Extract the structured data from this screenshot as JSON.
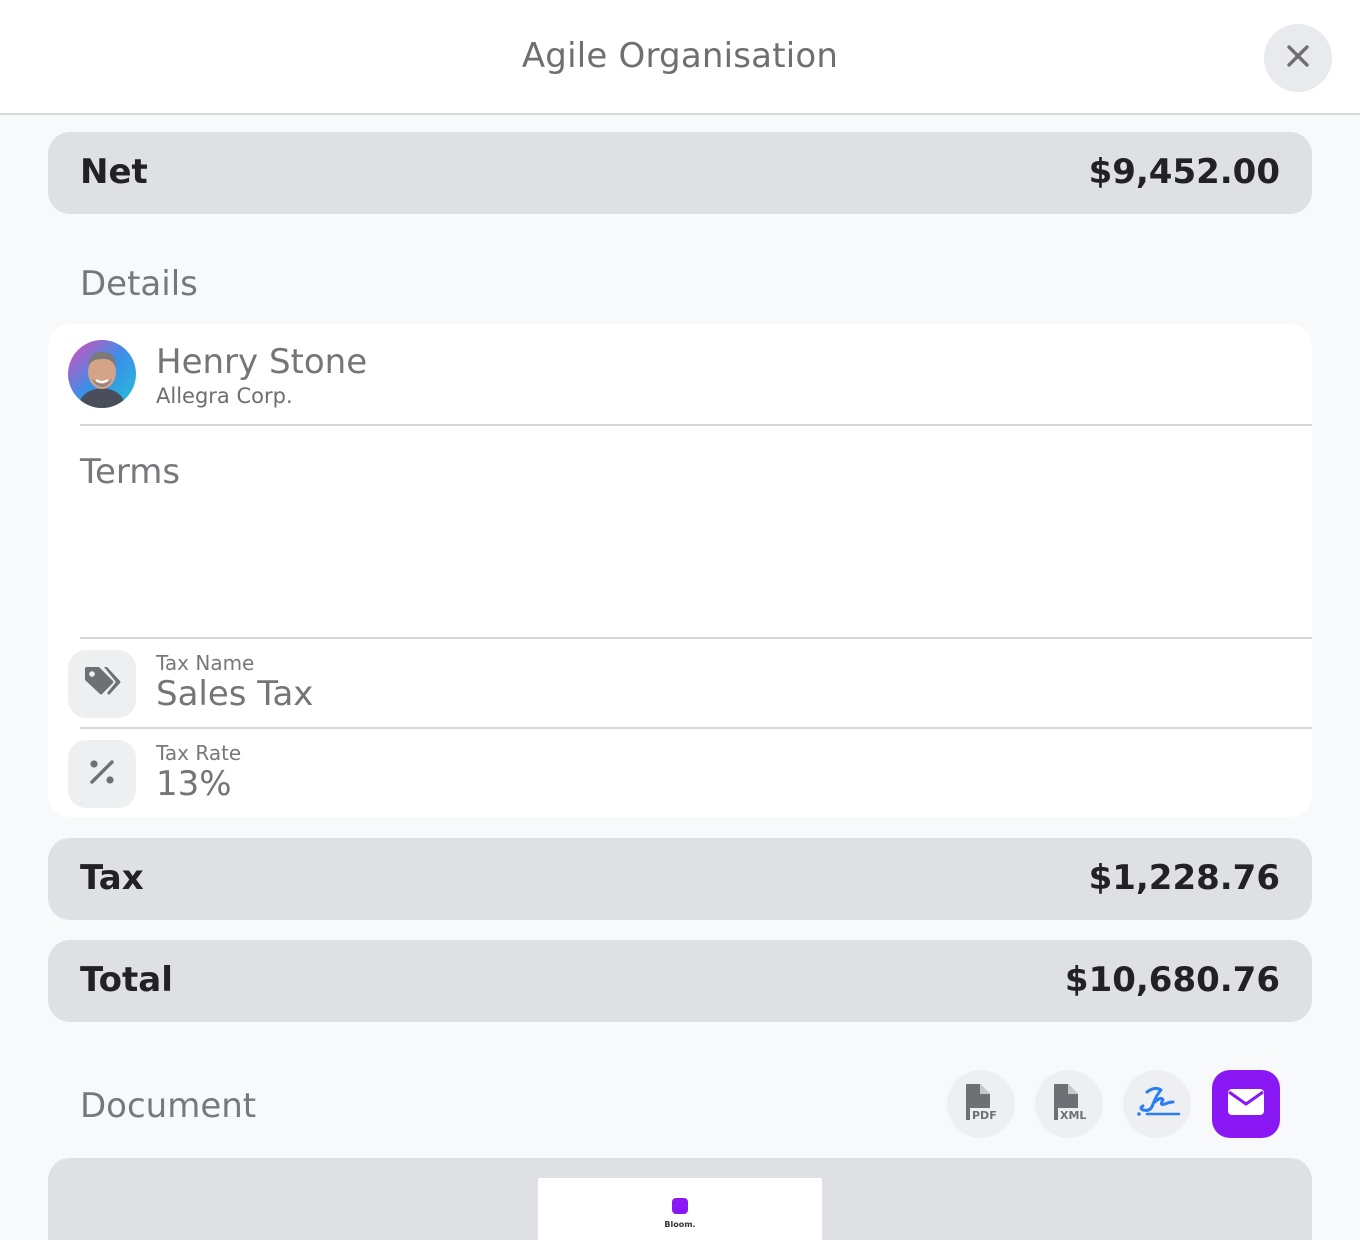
{
  "header": {
    "title": "Agile Organisation",
    "close_icon": "close-icon"
  },
  "net": {
    "label": "Net",
    "value": "$9,452.00"
  },
  "details": {
    "title": "Details",
    "contact": {
      "name": "Henry Stone",
      "company": "Allegra Corp."
    },
    "terms_label": "Terms",
    "tax_name": {
      "label": "Tax Name",
      "value": "Sales Tax",
      "icon": "tag-icon"
    },
    "tax_rate": {
      "label": "Tax Rate",
      "value": "13%",
      "icon": "percent-icon"
    }
  },
  "tax": {
    "label": "Tax",
    "value": "$1,228.76"
  },
  "total": {
    "label": "Total",
    "value": "$10,680.76"
  },
  "document": {
    "title": "Document",
    "actions": [
      {
        "icon": "pdf-file-icon",
        "label": "PDF"
      },
      {
        "icon": "xml-file-icon",
        "label": "XML"
      },
      {
        "icon": "signature-icon"
      },
      {
        "icon": "envelope-icon"
      }
    ],
    "preview_logo_text": "Bloom."
  },
  "colors": {
    "accent": "#8a18f5",
    "signature": "#2a7df4",
    "summary_bar": "#dfe0e3",
    "text_dark": "#222225",
    "text_muted": "#77787c"
  }
}
